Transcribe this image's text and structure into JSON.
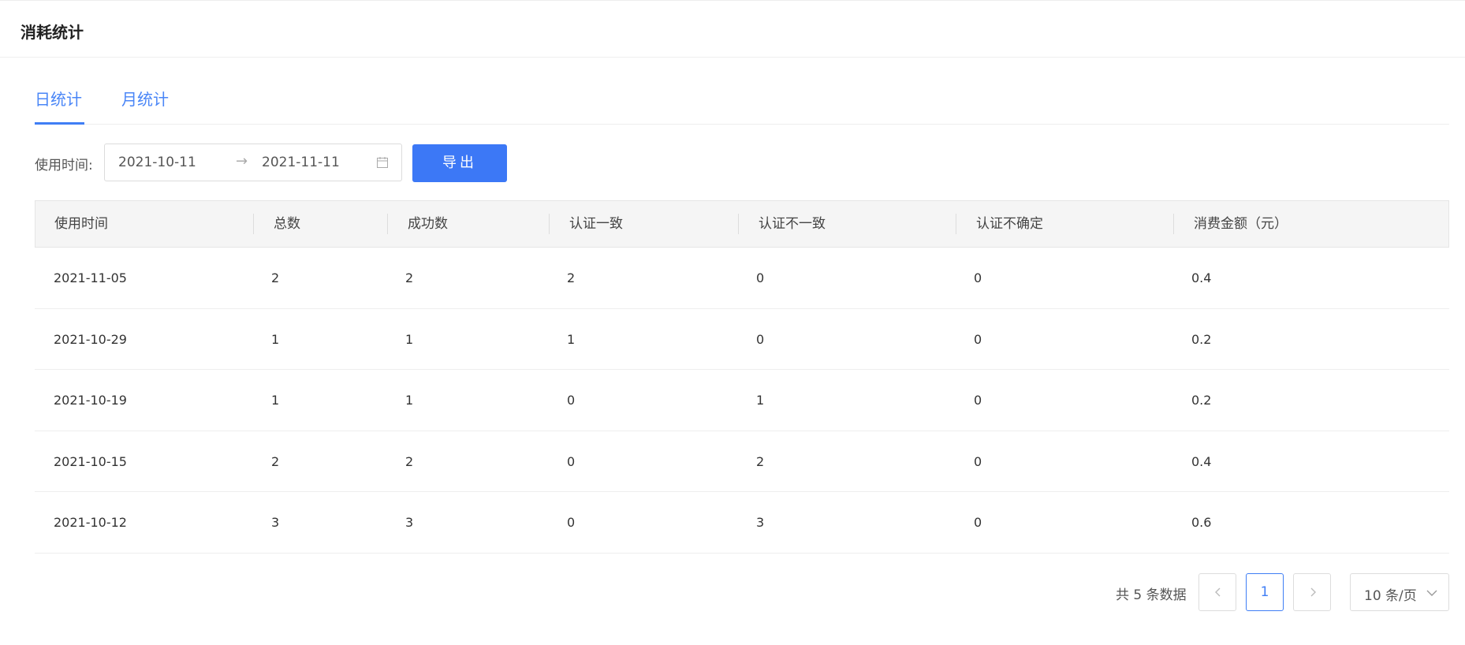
{
  "header": {
    "title": "消耗统计"
  },
  "tabs": [
    {
      "label": "日统计",
      "active": true
    },
    {
      "label": "月统计",
      "active": false
    }
  ],
  "filter": {
    "label": "使用时间:",
    "start_date": "2021-10-11",
    "end_date": "2021-11-11",
    "arrow": "→",
    "export_label": "导出"
  },
  "table": {
    "columns": [
      "使用时间",
      "总数",
      "成功数",
      "认证一致",
      "认证不一致",
      "认证不确定",
      "消费金额（元）"
    ],
    "rows": [
      [
        "2021-11-05",
        "2",
        "2",
        "2",
        "0",
        "0",
        "0.4"
      ],
      [
        "2021-10-29",
        "1",
        "1",
        "1",
        "0",
        "0",
        "0.2"
      ],
      [
        "2021-10-19",
        "1",
        "1",
        "0",
        "1",
        "0",
        "0.2"
      ],
      [
        "2021-10-15",
        "2",
        "2",
        "0",
        "2",
        "0",
        "0.4"
      ],
      [
        "2021-10-12",
        "3",
        "3",
        "0",
        "3",
        "0",
        "0.6"
      ]
    ]
  },
  "pagination": {
    "total_text": "共 5 条数据",
    "current_page": "1",
    "page_size": "10 条/页"
  },
  "colors": {
    "accent": "#3c78f6",
    "header_bg": "#f5f5f5"
  }
}
